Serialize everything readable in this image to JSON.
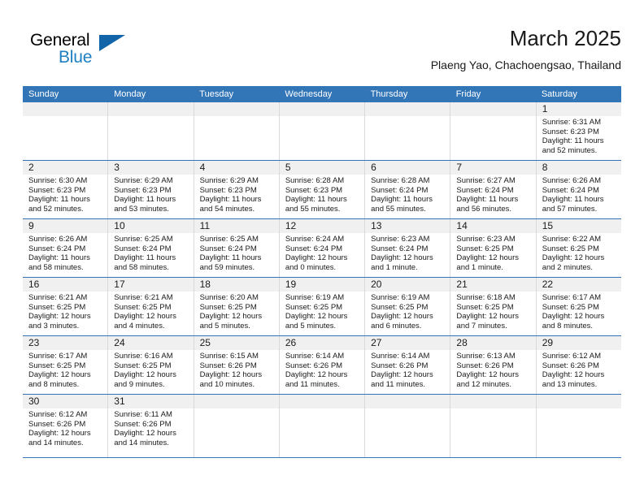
{
  "brand": {
    "word_one": "General",
    "word_two": "Blue",
    "triangle_color": "#1164A8",
    "blue_text_color": "#1E7FC2"
  },
  "header": {
    "title": "March 2025",
    "subtitle": "Plaeng Yao, Chachoengsao, Thailand"
  },
  "theme": {
    "header_blue": "#3376B8",
    "daynum_band": "#f0f0f0",
    "cell_border": "#d9d9d9"
  },
  "weekdays": [
    "Sunday",
    "Monday",
    "Tuesday",
    "Wednesday",
    "Thursday",
    "Friday",
    "Saturday"
  ],
  "weeks": [
    [
      {
        "day": "",
        "empty": true,
        "lines": []
      },
      {
        "day": "",
        "empty": true,
        "lines": []
      },
      {
        "day": "",
        "empty": true,
        "lines": []
      },
      {
        "day": "",
        "empty": true,
        "lines": []
      },
      {
        "day": "",
        "empty": true,
        "lines": []
      },
      {
        "day": "",
        "empty": true,
        "lines": []
      },
      {
        "day": "1",
        "empty": false,
        "lines": [
          "Sunrise: 6:31 AM",
          "Sunset: 6:23 PM",
          "Daylight: 11 hours",
          "and 52 minutes."
        ]
      }
    ],
    [
      {
        "day": "2",
        "empty": false,
        "lines": [
          "Sunrise: 6:30 AM",
          "Sunset: 6:23 PM",
          "Daylight: 11 hours",
          "and 52 minutes."
        ]
      },
      {
        "day": "3",
        "empty": false,
        "lines": [
          "Sunrise: 6:29 AM",
          "Sunset: 6:23 PM",
          "Daylight: 11 hours",
          "and 53 minutes."
        ]
      },
      {
        "day": "4",
        "empty": false,
        "lines": [
          "Sunrise: 6:29 AM",
          "Sunset: 6:23 PM",
          "Daylight: 11 hours",
          "and 54 minutes."
        ]
      },
      {
        "day": "5",
        "empty": false,
        "lines": [
          "Sunrise: 6:28 AM",
          "Sunset: 6:23 PM",
          "Daylight: 11 hours",
          "and 55 minutes."
        ]
      },
      {
        "day": "6",
        "empty": false,
        "lines": [
          "Sunrise: 6:28 AM",
          "Sunset: 6:24 PM",
          "Daylight: 11 hours",
          "and 55 minutes."
        ]
      },
      {
        "day": "7",
        "empty": false,
        "lines": [
          "Sunrise: 6:27 AM",
          "Sunset: 6:24 PM",
          "Daylight: 11 hours",
          "and 56 minutes."
        ]
      },
      {
        "day": "8",
        "empty": false,
        "lines": [
          "Sunrise: 6:26 AM",
          "Sunset: 6:24 PM",
          "Daylight: 11 hours",
          "and 57 minutes."
        ]
      }
    ],
    [
      {
        "day": "9",
        "empty": false,
        "lines": [
          "Sunrise: 6:26 AM",
          "Sunset: 6:24 PM",
          "Daylight: 11 hours",
          "and 58 minutes."
        ]
      },
      {
        "day": "10",
        "empty": false,
        "lines": [
          "Sunrise: 6:25 AM",
          "Sunset: 6:24 PM",
          "Daylight: 11 hours",
          "and 58 minutes."
        ]
      },
      {
        "day": "11",
        "empty": false,
        "lines": [
          "Sunrise: 6:25 AM",
          "Sunset: 6:24 PM",
          "Daylight: 11 hours",
          "and 59 minutes."
        ]
      },
      {
        "day": "12",
        "empty": false,
        "lines": [
          "Sunrise: 6:24 AM",
          "Sunset: 6:24 PM",
          "Daylight: 12 hours",
          "and 0 minutes."
        ]
      },
      {
        "day": "13",
        "empty": false,
        "lines": [
          "Sunrise: 6:23 AM",
          "Sunset: 6:24 PM",
          "Daylight: 12 hours",
          "and 1 minute."
        ]
      },
      {
        "day": "14",
        "empty": false,
        "lines": [
          "Sunrise: 6:23 AM",
          "Sunset: 6:25 PM",
          "Daylight: 12 hours",
          "and 1 minute."
        ]
      },
      {
        "day": "15",
        "empty": false,
        "lines": [
          "Sunrise: 6:22 AM",
          "Sunset: 6:25 PM",
          "Daylight: 12 hours",
          "and 2 minutes."
        ]
      }
    ],
    [
      {
        "day": "16",
        "empty": false,
        "lines": [
          "Sunrise: 6:21 AM",
          "Sunset: 6:25 PM",
          "Daylight: 12 hours",
          "and 3 minutes."
        ]
      },
      {
        "day": "17",
        "empty": false,
        "lines": [
          "Sunrise: 6:21 AM",
          "Sunset: 6:25 PM",
          "Daylight: 12 hours",
          "and 4 minutes."
        ]
      },
      {
        "day": "18",
        "empty": false,
        "lines": [
          "Sunrise: 6:20 AM",
          "Sunset: 6:25 PM",
          "Daylight: 12 hours",
          "and 5 minutes."
        ]
      },
      {
        "day": "19",
        "empty": false,
        "lines": [
          "Sunrise: 6:19 AM",
          "Sunset: 6:25 PM",
          "Daylight: 12 hours",
          "and 5 minutes."
        ]
      },
      {
        "day": "20",
        "empty": false,
        "lines": [
          "Sunrise: 6:19 AM",
          "Sunset: 6:25 PM",
          "Daylight: 12 hours",
          "and 6 minutes."
        ]
      },
      {
        "day": "21",
        "empty": false,
        "lines": [
          "Sunrise: 6:18 AM",
          "Sunset: 6:25 PM",
          "Daylight: 12 hours",
          "and 7 minutes."
        ]
      },
      {
        "day": "22",
        "empty": false,
        "lines": [
          "Sunrise: 6:17 AM",
          "Sunset: 6:25 PM",
          "Daylight: 12 hours",
          "and 8 minutes."
        ]
      }
    ],
    [
      {
        "day": "23",
        "empty": false,
        "lines": [
          "Sunrise: 6:17 AM",
          "Sunset: 6:25 PM",
          "Daylight: 12 hours",
          "and 8 minutes."
        ]
      },
      {
        "day": "24",
        "empty": false,
        "lines": [
          "Sunrise: 6:16 AM",
          "Sunset: 6:25 PM",
          "Daylight: 12 hours",
          "and 9 minutes."
        ]
      },
      {
        "day": "25",
        "empty": false,
        "lines": [
          "Sunrise: 6:15 AM",
          "Sunset: 6:26 PM",
          "Daylight: 12 hours",
          "and 10 minutes."
        ]
      },
      {
        "day": "26",
        "empty": false,
        "lines": [
          "Sunrise: 6:14 AM",
          "Sunset: 6:26 PM",
          "Daylight: 12 hours",
          "and 11 minutes."
        ]
      },
      {
        "day": "27",
        "empty": false,
        "lines": [
          "Sunrise: 6:14 AM",
          "Sunset: 6:26 PM",
          "Daylight: 12 hours",
          "and 11 minutes."
        ]
      },
      {
        "day": "28",
        "empty": false,
        "lines": [
          "Sunrise: 6:13 AM",
          "Sunset: 6:26 PM",
          "Daylight: 12 hours",
          "and 12 minutes."
        ]
      },
      {
        "day": "29",
        "empty": false,
        "lines": [
          "Sunrise: 6:12 AM",
          "Sunset: 6:26 PM",
          "Daylight: 12 hours",
          "and 13 minutes."
        ]
      }
    ],
    [
      {
        "day": "30",
        "empty": false,
        "lines": [
          "Sunrise: 6:12 AM",
          "Sunset: 6:26 PM",
          "Daylight: 12 hours",
          "and 14 minutes."
        ]
      },
      {
        "day": "31",
        "empty": false,
        "lines": [
          "Sunrise: 6:11 AM",
          "Sunset: 6:26 PM",
          "Daylight: 12 hours",
          "and 14 minutes."
        ]
      },
      {
        "day": "",
        "empty": true,
        "lines": []
      },
      {
        "day": "",
        "empty": true,
        "lines": []
      },
      {
        "day": "",
        "empty": true,
        "lines": []
      },
      {
        "day": "",
        "empty": true,
        "lines": []
      },
      {
        "day": "",
        "empty": true,
        "lines": []
      }
    ]
  ]
}
